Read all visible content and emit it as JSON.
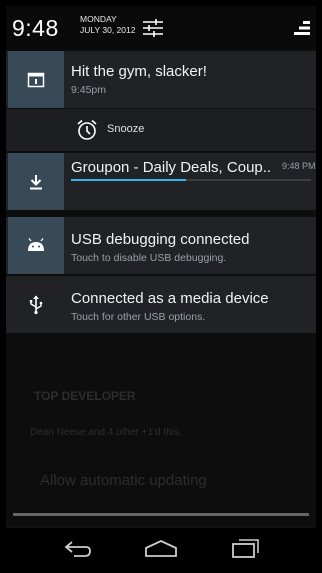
{
  "status": {
    "time": "9:48",
    "day": "MONDAY",
    "date": "JULY 30, 2012"
  },
  "notifications": [
    {
      "icon": "calendar-icon",
      "title": "Hit the gym, slacker!",
      "subtitle": "9:45pm"
    },
    {
      "icon": "download-icon",
      "title": "Groupon - Daily Deals, Coup..",
      "time": "9:48 PM",
      "progress": 0.48
    },
    {
      "icon": "android-icon",
      "title": "USB debugging connected",
      "subtitle": "Touch to disable USB debugging."
    },
    {
      "icon": "usb-icon",
      "title": "Connected as a media device",
      "subtitle": "Touch for other USB options."
    }
  ],
  "snooze": {
    "label": "Snooze",
    "icon": "alarm-clock-icon"
  },
  "background": {
    "top_developer": "TOP DEVELOPER",
    "meta_line": "Dean Neese and 4 other +1'd this.",
    "auto_update": "Allow automatic updating"
  },
  "navigation": {
    "back": "back-icon",
    "home": "home-icon",
    "recents": "recents-icon"
  },
  "colors": {
    "accent": "#33b5e5",
    "icon_bg": "#384a58",
    "card_bg": "#202226"
  }
}
